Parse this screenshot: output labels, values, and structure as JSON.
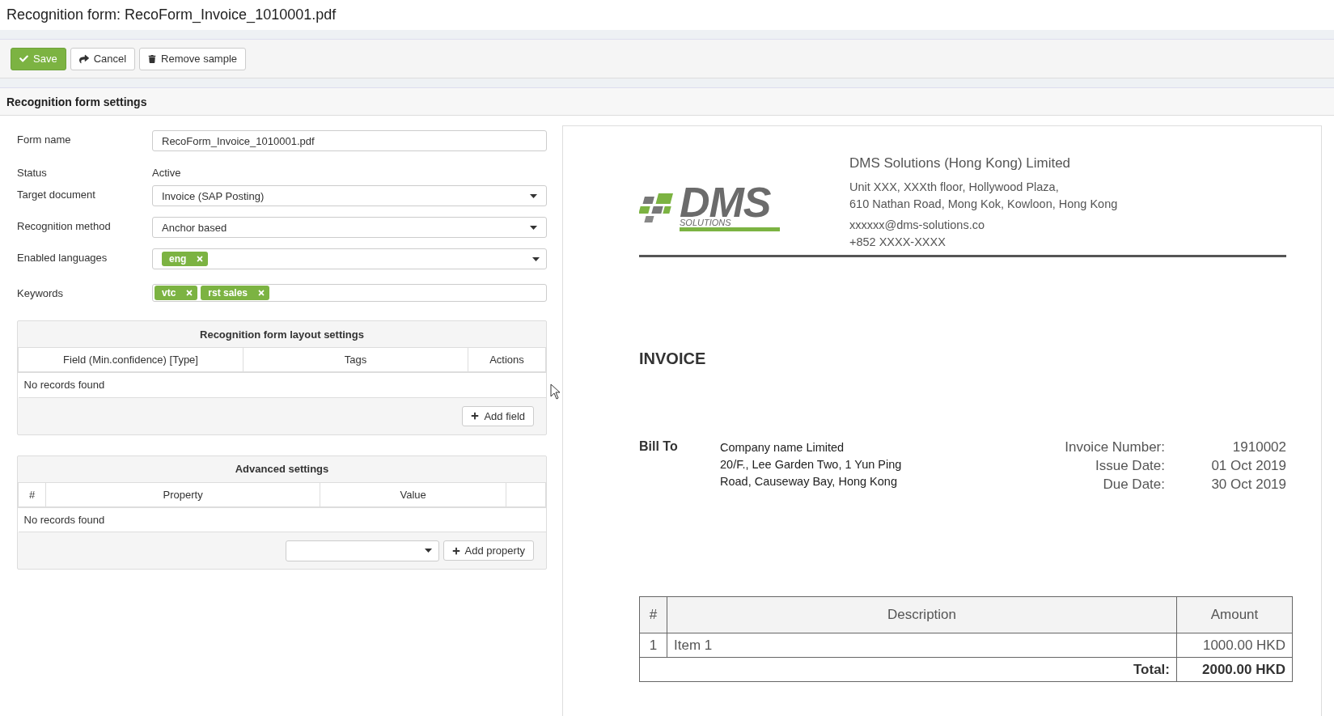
{
  "window": {
    "title": "Recognition form: RecoForm_Invoice_1010001.pdf"
  },
  "toolbar": {
    "buttons": [
      {
        "label": "Save",
        "kind": "save"
      },
      {
        "label": "Cancel",
        "kind": "cancel"
      },
      {
        "label": "Remove sample",
        "kind": "remove"
      }
    ]
  },
  "section_title": "Recognition form settings",
  "form": {
    "fields": [
      {
        "label": "Form name",
        "kind": "input",
        "value": "RecoForm_Invoice_1010001.pdf"
      },
      {
        "label": "Status",
        "kind": "text",
        "value": "Active"
      },
      {
        "label": "Target document",
        "kind": "select",
        "value": "Invoice (SAP Posting)"
      },
      {
        "label": "Recognition method",
        "kind": "select",
        "value": "Anchor based"
      },
      {
        "label": "Enabled languages",
        "kind": "tag_select",
        "tags": [
          "eng"
        ]
      },
      {
        "label": "Keywords",
        "kind": "tags",
        "tags": [
          "vtc",
          "rst sales"
        ]
      }
    ]
  },
  "layout_settings": {
    "title": "Recognition form layout settings",
    "columns": [
      "Field (Min.confidence) [Type]",
      "Tags",
      "Actions"
    ],
    "empty": "No records found",
    "button": "Add field"
  },
  "advanced_settings": {
    "title": "Advanced settings",
    "columns": [
      "#",
      "Property",
      "Value"
    ],
    "empty": "No records found",
    "button": "Add property"
  },
  "preview": {
    "logo": {
      "mark": "DMS",
      "tagline": "SOLUTIONS"
    },
    "company": {
      "name": "DMS Solutions (Hong Kong) Limited",
      "address": [
        "Unit XXX, XXXth floor, Hollywood Plaza,",
        "610 Nathan Road, Mong Kok, Kowloon, Hong Kong"
      ],
      "email": "xxxxxx@dms-solutions.co",
      "phone": "+852 XXXX-XXXX"
    },
    "heading": "INVOICE",
    "bill_to": {
      "label": "Bill To",
      "lines": [
        "Company name Limited",
        "20/F., Lee Garden Two, 1 Yun Ping",
        "Road, Causeway Bay, Hong Kong"
      ]
    },
    "meta": [
      {
        "label": "Invoice Number:",
        "value": "1910002"
      },
      {
        "label": "Issue Date:",
        "value": "01 Oct 2019"
      },
      {
        "label": "Due Date:",
        "value": "30 Oct 2019"
      }
    ],
    "table": {
      "columns": [
        "#",
        "Description",
        "Amount"
      ],
      "rows": [
        [
          "1",
          "Item 1",
          "1000.00 HKD"
        ]
      ],
      "total_label": "Total:",
      "total": "2000.00 HKD"
    }
  }
}
